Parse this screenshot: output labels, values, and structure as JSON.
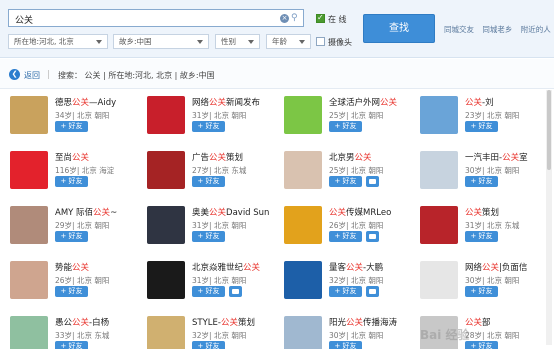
{
  "search": {
    "keyword": "公关",
    "location": "所在地:河北, 北京",
    "hometown": "故乡:中国",
    "gender": "性别",
    "age": "年龄",
    "online_label": "在 线",
    "camera_label": "摄像头",
    "button_label": "查找",
    "links": [
      "同城交友",
      "同城老乡",
      "附近的人"
    ]
  },
  "breadcrumb": {
    "back_label": "返回",
    "conditions": "搜索： 公关 | 所在地:河北, 北京 | 故乡:中国"
  },
  "results": [
    {
      "name_pre": "德思",
      "name_hl": "公关",
      "name_post": "—Aidy",
      "meta": "34岁| 北京 朝阳",
      "msg": false,
      "avatar_color": "#c9a25d"
    },
    {
      "name_pre": "网络",
      "name_hl": "公关",
      "name_post": "新闻发布",
      "meta": "31岁| 北京 朝阳",
      "msg": false,
      "avatar_color": "#c81f2b"
    },
    {
      "name_pre": "全球活户外网",
      "name_hl": "公关",
      "name_post": "",
      "meta": "25岁| 北京 朝阳",
      "msg": false,
      "avatar_color": "#7cc645"
    },
    {
      "name_pre": "",
      "name_hl": "公关",
      "name_post": "-刘",
      "meta": "23岁| 北京 朝阳",
      "msg": false,
      "avatar_color": "#6aa4d8"
    },
    {
      "name_pre": "至尚",
      "name_hl": "公关",
      "name_post": "",
      "meta": "116岁| 北京 海淀",
      "msg": false,
      "avatar_color": "#e3222c"
    },
    {
      "name_pre": "广告",
      "name_hl": "公关",
      "name_post": "策划",
      "meta": "27岁| 北京 东城",
      "msg": false,
      "avatar_color": "#a52324"
    },
    {
      "name_pre": "北京男",
      "name_hl": "公关",
      "name_post": "",
      "meta": "25岁| 北京 朝阳",
      "msg": true,
      "avatar_color": "#d9c2b0"
    },
    {
      "name_pre": "一汽丰田-",
      "name_hl": "公关",
      "name_post": "室",
      "meta": "30岁| 北京 朝阳",
      "msg": false,
      "avatar_color": "#c7d3df"
    },
    {
      "name_pre": "AMY 际佰",
      "name_hl": "公关",
      "name_post": "~",
      "meta": "29岁| 北京 朝阳",
      "msg": false,
      "avatar_color": "#b08b7a"
    },
    {
      "name_pre": "奥美",
      "name_hl": "公关",
      "name_post": "David Sun",
      "meta": "31岁| 北京 朝阳",
      "msg": false,
      "avatar_color": "#2f3442"
    },
    {
      "name_pre": "",
      "name_hl": "公关",
      "name_post": "传媒MRLeo",
      "meta": "26岁| 北京 朝阳",
      "msg": true,
      "avatar_color": "#e2a21c"
    },
    {
      "name_pre": "",
      "name_hl": "公关",
      "name_post": "策划",
      "meta": "31岁| 北京 东城",
      "msg": false,
      "avatar_color": "#b8242a"
    },
    {
      "name_pre": "势能",
      "name_hl": "公关",
      "name_post": "",
      "meta": "26岁| 北京 朝阳",
      "msg": false,
      "avatar_color": "#cfa58f"
    },
    {
      "name_pre": "北京焱雅世纪",
      "name_hl": "公关",
      "name_post": "",
      "meta": "31岁| 北京 朝阳",
      "msg": true,
      "avatar_color": "#1a1a1a"
    },
    {
      "name_pre": "量客",
      "name_hl": "公关",
      "name_post": "-大鹏",
      "meta": "32岁| 北京 朝阳",
      "msg": true,
      "avatar_color": "#1d5fa8"
    },
    {
      "name_pre": "网络",
      "name_hl": "公关",
      "name_post": "|负面信",
      "meta": "30岁| 北京 朝阳",
      "msg": false,
      "avatar_color": "#e6e6e6"
    },
    {
      "name_pre": "愚公",
      "name_hl": "公关",
      "name_post": "-白杨",
      "meta": "33岁| 北京 东城",
      "msg": false,
      "avatar_color": "#8fc0a0"
    },
    {
      "name_pre": "STYLE-",
      "name_hl": "公关",
      "name_post": "策划",
      "meta": "32岁| 北京 朝阳",
      "msg": false,
      "avatar_color": "#d0b070"
    },
    {
      "name_pre": "阳光",
      "name_hl": "公关",
      "name_post": "传播海涛",
      "meta": "30岁| 北京 朝阳",
      "msg": false,
      "avatar_color": "#a0b8d0"
    },
    {
      "name_pre": "",
      "name_hl": "公关",
      "name_post": "部",
      "meta": "28岁| 北京 朝阳",
      "msg": false,
      "avatar_color": "#c8c8c8"
    }
  ],
  "add_friend_label": "+ 好友",
  "watermark": "Bai 经验"
}
